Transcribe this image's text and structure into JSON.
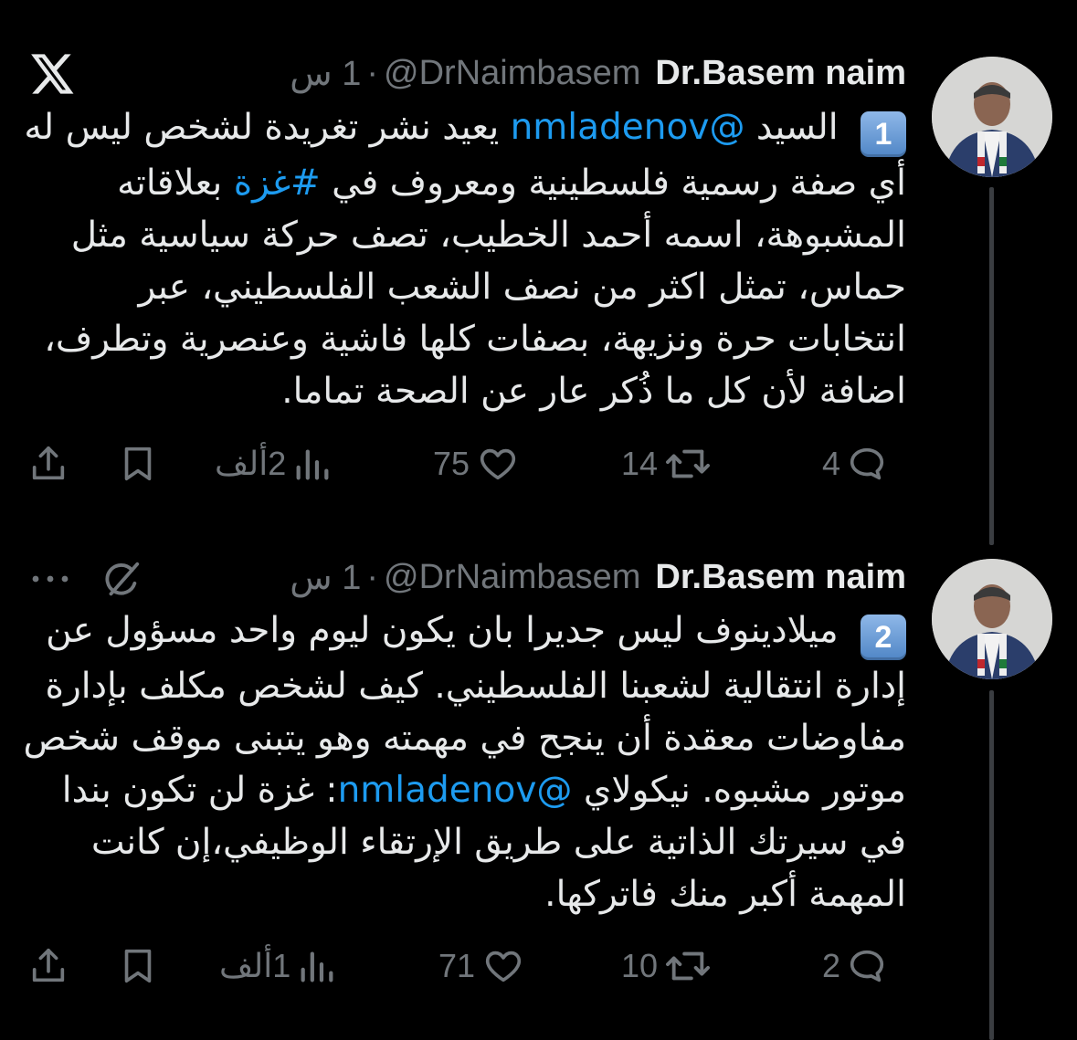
{
  "brand": {
    "logo_icon": "x-logo-icon"
  },
  "tweets": [
    {
      "author_name": "Dr.Basem naim",
      "handle": "@DrNaimbasem",
      "separator": "·",
      "time": "1 س",
      "number_badge": "1",
      "body": {
        "p1": " السيد ",
        "mention1": "@nmladenov",
        "p2": " يعيد نشر تغريدة لشخص ليس له أي صفة رسمية فلسطينية ومعروف في ",
        "hashtag": "#غزة",
        "p3": " بعلاقاته المشبوهة، اسمه أحمد الخطيب، تصف حركة سياسية مثل حماس، تمثل اكثر من نصف الشعب الفلسطيني، عبر انتخابات حرة ونزيهة، بصفات كلها فاشية وعنصرية وتطرف، اضافة لأن كل ما ذُكر عار عن الصحة تماما."
      },
      "actions": {
        "replies": "4",
        "reposts": "14",
        "likes": "75",
        "views": "2ألف"
      }
    },
    {
      "author_name": "Dr.Basem naim",
      "handle": "@DrNaimbasem",
      "separator": "·",
      "time": "1 س",
      "number_badge": "2",
      "body": {
        "p1": " ميلادينوف ليس جديرا بان يكون ليوم واحد مسؤول عن إدارة انتقالية لشعبنا الفلسطيني. كيف لشخص مكلف بإدارة مفاوضات معقدة أن ينجح في مهمته وهو يتبنى موقف شخص موتور مشبوه. نيكولاي ",
        "mention1": "@nmladenov",
        "p2": ": غزة لن تكون بندا في سيرتك الذاتية على طريق الإرتقاء الوظيفي،إن كانت المهمة أكبر منك فاتركها."
      },
      "actions": {
        "replies": "2",
        "reposts": "10",
        "likes": "71",
        "views": "1ألف"
      }
    }
  ],
  "colors": {
    "background": "#000000",
    "text": "#e7e9ea",
    "secondary": "#71767b",
    "link": "#1d9bf0"
  }
}
